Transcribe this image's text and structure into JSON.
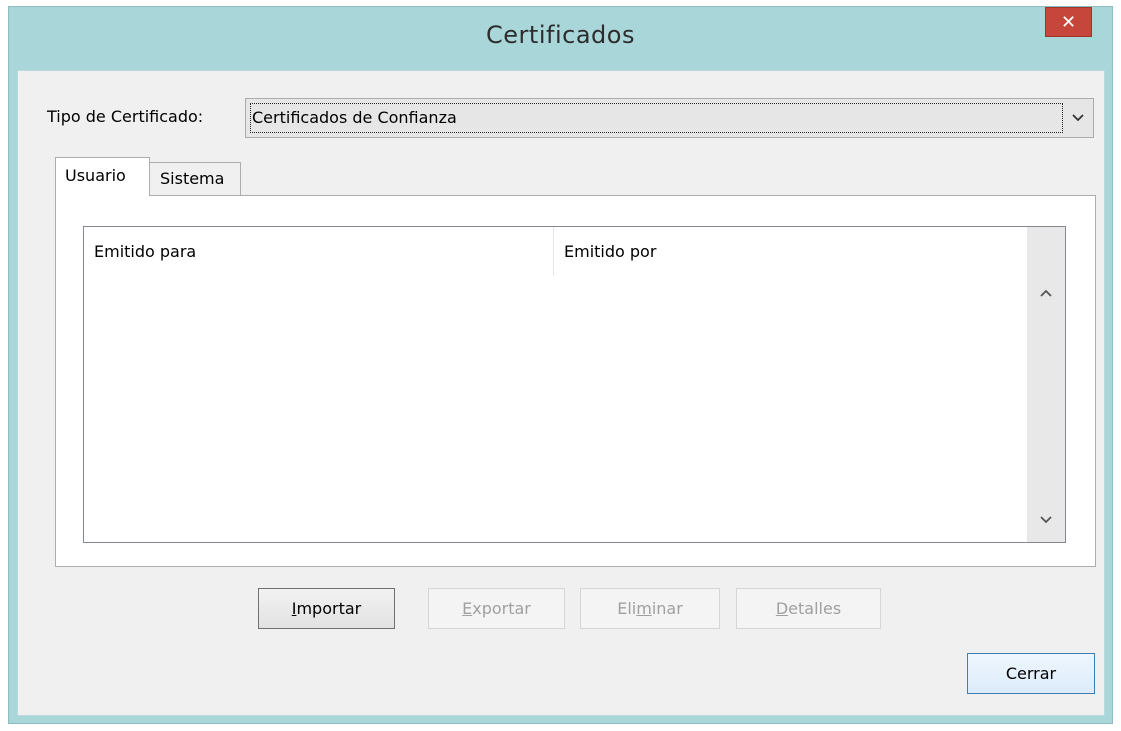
{
  "window": {
    "title": "Certificados",
    "close_glyph": "✕"
  },
  "cert_type": {
    "label": "Tipo de Certificado:",
    "selected": "Certificados de Confianza"
  },
  "tabs": [
    {
      "label": "Usuario",
      "active": true
    },
    {
      "label": "Sistema",
      "active": false
    }
  ],
  "list": {
    "columns": [
      "Emitido para",
      "Emitido por"
    ],
    "rows": []
  },
  "buttons": {
    "import": {
      "pre": "",
      "mnemonic": "I",
      "post": "mportar",
      "enabled": true
    },
    "export": {
      "pre": "",
      "mnemonic": "E",
      "post": "xportar",
      "enabled": false
    },
    "delete": {
      "pre": "Eli",
      "mnemonic": "m",
      "post": "inar",
      "enabled": false
    },
    "details": {
      "pre": "",
      "mnemonic": "D",
      "post": "etalles",
      "enabled": false
    },
    "close": {
      "label": "Cerrar",
      "enabled": true
    }
  },
  "colors": {
    "frame": "#a9d6d9",
    "close_button": "#c7463c",
    "default_button_border": "#3c7fb1"
  },
  "icons": {
    "combo_arrow": "chevron-down-icon",
    "scroll_up": "chevron-up-icon",
    "scroll_down": "chevron-down-icon"
  }
}
